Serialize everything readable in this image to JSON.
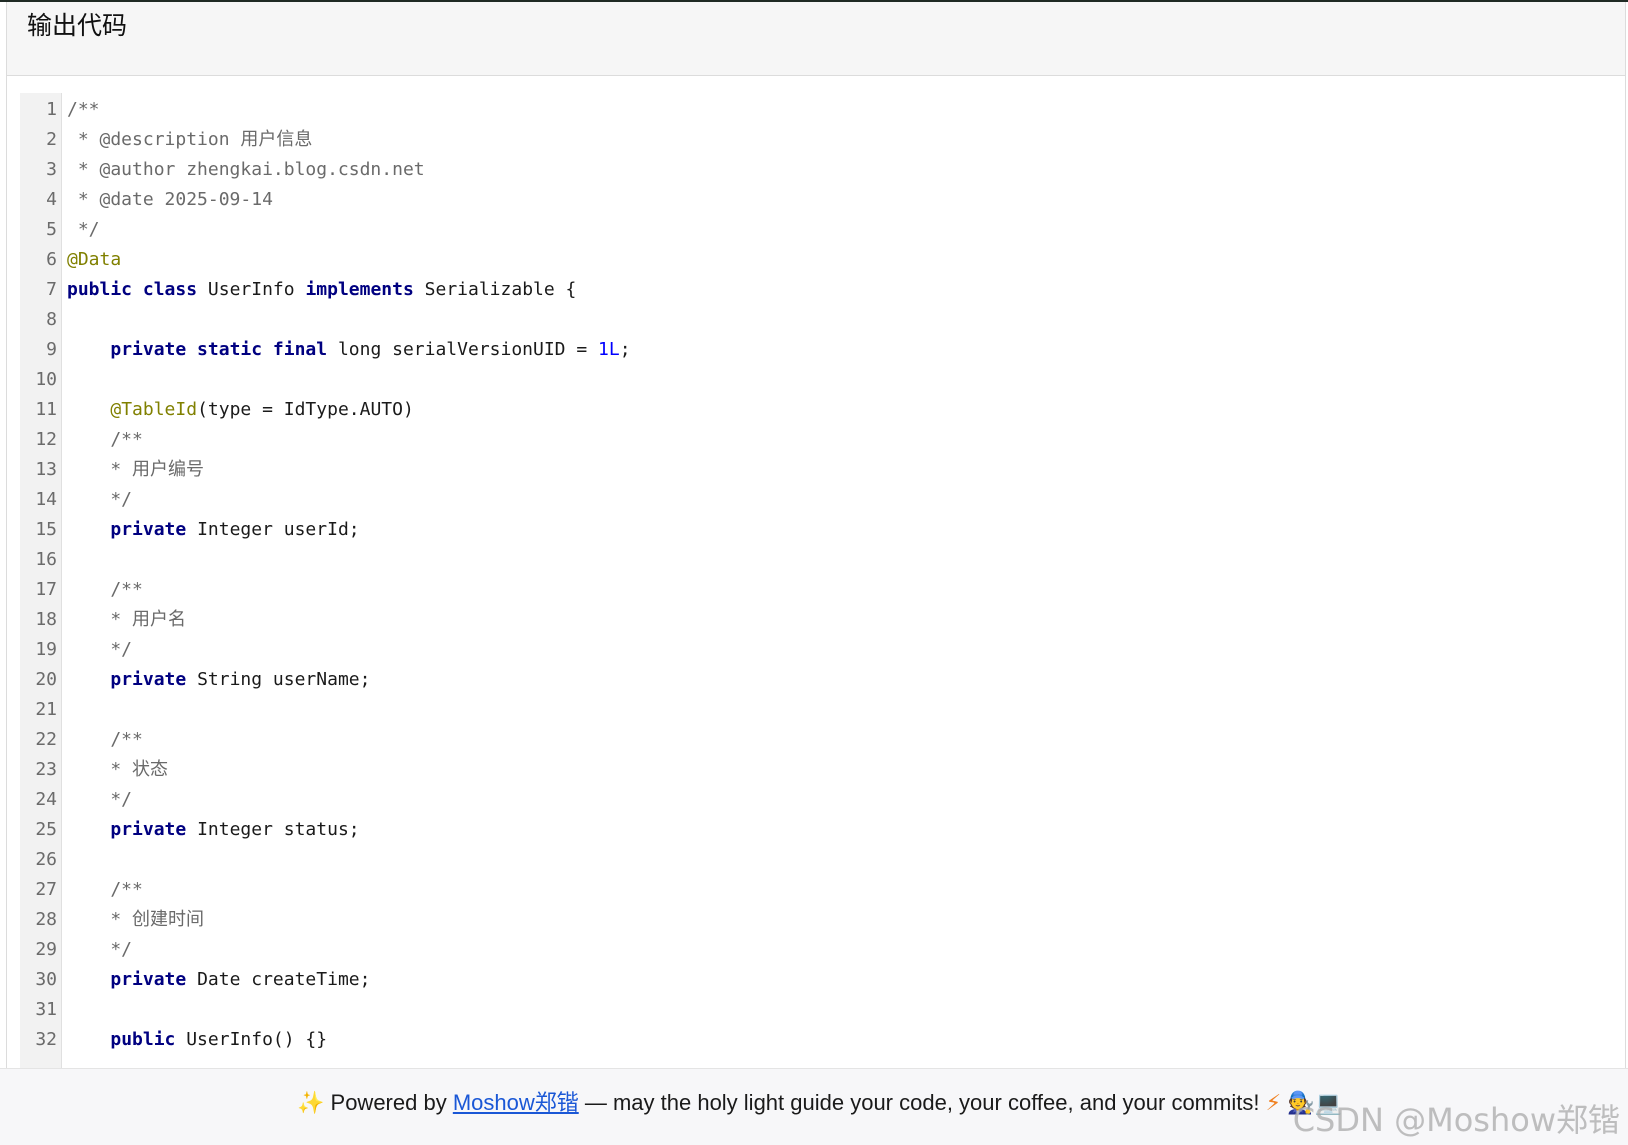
{
  "panel": {
    "title": "输出代码"
  },
  "code": {
    "lines": [
      {
        "n": "1",
        "tokens": [
          {
            "t": "comment",
            "v": "/**"
          }
        ]
      },
      {
        "n": "2",
        "tokens": [
          {
            "t": "comment",
            "v": " * @description 用户信息"
          }
        ]
      },
      {
        "n": "3",
        "tokens": [
          {
            "t": "comment",
            "v": " * @author zhengkai.blog.csdn.net"
          }
        ]
      },
      {
        "n": "4",
        "tokens": [
          {
            "t": "comment",
            "v": " * @date 2025-09-14"
          }
        ]
      },
      {
        "n": "5",
        "tokens": [
          {
            "t": "comment",
            "v": " */"
          }
        ]
      },
      {
        "n": "6",
        "tokens": [
          {
            "t": "annotation",
            "v": "@Data"
          }
        ]
      },
      {
        "n": "7",
        "tokens": [
          {
            "t": "keyword",
            "v": "public class "
          },
          {
            "t": "plain",
            "v": "UserInfo "
          },
          {
            "t": "keyword",
            "v": "implements "
          },
          {
            "t": "plain",
            "v": "Serializable {"
          }
        ]
      },
      {
        "n": "8",
        "tokens": []
      },
      {
        "n": "9",
        "tokens": [
          {
            "t": "plain",
            "v": "    "
          },
          {
            "t": "keyword",
            "v": "private static final "
          },
          {
            "t": "plain",
            "v": "long serialVersionUID = "
          },
          {
            "t": "number",
            "v": "1L"
          },
          {
            "t": "plain",
            "v": ";"
          }
        ]
      },
      {
        "n": "10",
        "tokens": []
      },
      {
        "n": "11",
        "tokens": [
          {
            "t": "plain",
            "v": "    "
          },
          {
            "t": "annotation",
            "v": "@TableId"
          },
          {
            "t": "plain",
            "v": "(type = IdType.AUTO)"
          }
        ]
      },
      {
        "n": "12",
        "tokens": [
          {
            "t": "comment",
            "v": "    /**"
          }
        ]
      },
      {
        "n": "13",
        "tokens": [
          {
            "t": "comment",
            "v": "    * 用户编号"
          }
        ]
      },
      {
        "n": "14",
        "tokens": [
          {
            "t": "comment",
            "v": "    */"
          }
        ]
      },
      {
        "n": "15",
        "tokens": [
          {
            "t": "plain",
            "v": "    "
          },
          {
            "t": "keyword",
            "v": "private "
          },
          {
            "t": "plain",
            "v": "Integer userId;"
          }
        ]
      },
      {
        "n": "16",
        "tokens": []
      },
      {
        "n": "17",
        "tokens": [
          {
            "t": "comment",
            "v": "    /**"
          }
        ]
      },
      {
        "n": "18",
        "tokens": [
          {
            "t": "comment",
            "v": "    * 用户名"
          }
        ]
      },
      {
        "n": "19",
        "tokens": [
          {
            "t": "comment",
            "v": "    */"
          }
        ]
      },
      {
        "n": "20",
        "tokens": [
          {
            "t": "plain",
            "v": "    "
          },
          {
            "t": "keyword",
            "v": "private "
          },
          {
            "t": "plain",
            "v": "String userName;"
          }
        ]
      },
      {
        "n": "21",
        "tokens": []
      },
      {
        "n": "22",
        "tokens": [
          {
            "t": "comment",
            "v": "    /**"
          }
        ]
      },
      {
        "n": "23",
        "tokens": [
          {
            "t": "comment",
            "v": "    * 状态"
          }
        ]
      },
      {
        "n": "24",
        "tokens": [
          {
            "t": "comment",
            "v": "    */"
          }
        ]
      },
      {
        "n": "25",
        "tokens": [
          {
            "t": "plain",
            "v": "    "
          },
          {
            "t": "keyword",
            "v": "private "
          },
          {
            "t": "plain",
            "v": "Integer status;"
          }
        ]
      },
      {
        "n": "26",
        "tokens": []
      },
      {
        "n": "27",
        "tokens": [
          {
            "t": "comment",
            "v": "    /**"
          }
        ]
      },
      {
        "n": "28",
        "tokens": [
          {
            "t": "comment",
            "v": "    * 创建时间"
          }
        ]
      },
      {
        "n": "29",
        "tokens": [
          {
            "t": "comment",
            "v": "    */"
          }
        ]
      },
      {
        "n": "30",
        "tokens": [
          {
            "t": "plain",
            "v": "    "
          },
          {
            "t": "keyword",
            "v": "private "
          },
          {
            "t": "plain",
            "v": "Date createTime;"
          }
        ]
      },
      {
        "n": "31",
        "tokens": []
      },
      {
        "n": "32",
        "tokens": [
          {
            "t": "plain",
            "v": "    "
          },
          {
            "t": "keyword",
            "v": "public "
          },
          {
            "t": "plain",
            "v": "UserInfo() {}"
          }
        ]
      }
    ]
  },
  "footer": {
    "sparkle_icon": "✨",
    "prefix": " Powered by ",
    "link_label": "Moshow郑锴",
    "suffix": " — may the holy light guide your code, your coffee, and your commits! ",
    "bolt_icon": "⚡",
    "person_icon": "🧑‍🔧",
    "laptop_icon": "💻"
  },
  "watermark": {
    "text": "CSDN @Moshow郑锴"
  },
  "colors": {
    "keyword": "#000080",
    "annotation": "#808000",
    "comment": "#6a6a6a",
    "number": "#0000ff",
    "link": "#1a57d6"
  }
}
